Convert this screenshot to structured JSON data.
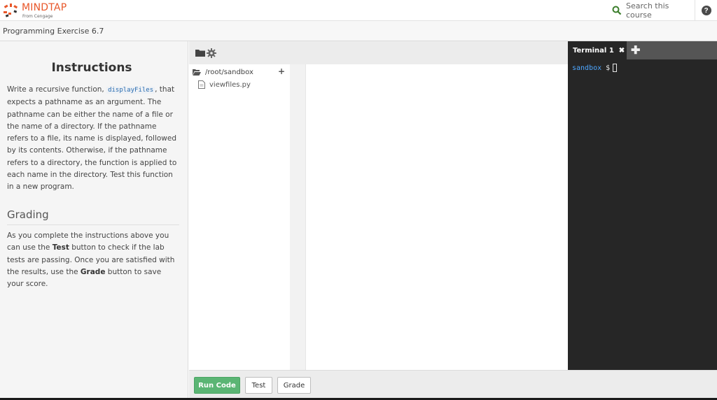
{
  "header": {
    "brand": "MINDTAP",
    "brand_sub": "From Cengage",
    "search_placeholder": "Search this course",
    "help_glyph": "?",
    "brand_color": "#e8572a"
  },
  "title_bar": {
    "title": "Programming Exercise 6.7"
  },
  "instructions": {
    "heading": "Instructions",
    "body_pre": "Write a recursive function, ",
    "code": "displayFiles",
    "body_post": ", that expects a pathname as an argument. The pathname can be either the name of a file or the name of a directory. If the pathname refers to a file, its name is displayed, followed by its contents. Otherwise, if the pathname refers to a directory, the function is applied to each name in the directory. Test this function in a new program.",
    "grading_heading": "Grading",
    "grading_1": "As you complete the instructions above you can use the ",
    "grading_test": "Test",
    "grading_2": " button to check if the lab tests are passing. Once you are satisfied with the results, use the ",
    "grading_grade": "Grade",
    "grading_3": " button to save your score."
  },
  "file_tree": {
    "root": "/root/sandbox",
    "add_glyph": "+",
    "files": [
      "viewfiles.py"
    ]
  },
  "terminal": {
    "tab_label": "Terminal 1",
    "close_glyph": "✖",
    "add_glyph": "✚",
    "prompt_dir": "sandbox",
    "prompt_symbol": "$"
  },
  "actions": {
    "run": "Run Code",
    "test": "Test",
    "grade": "Grade",
    "run_color": "#5bb574"
  }
}
